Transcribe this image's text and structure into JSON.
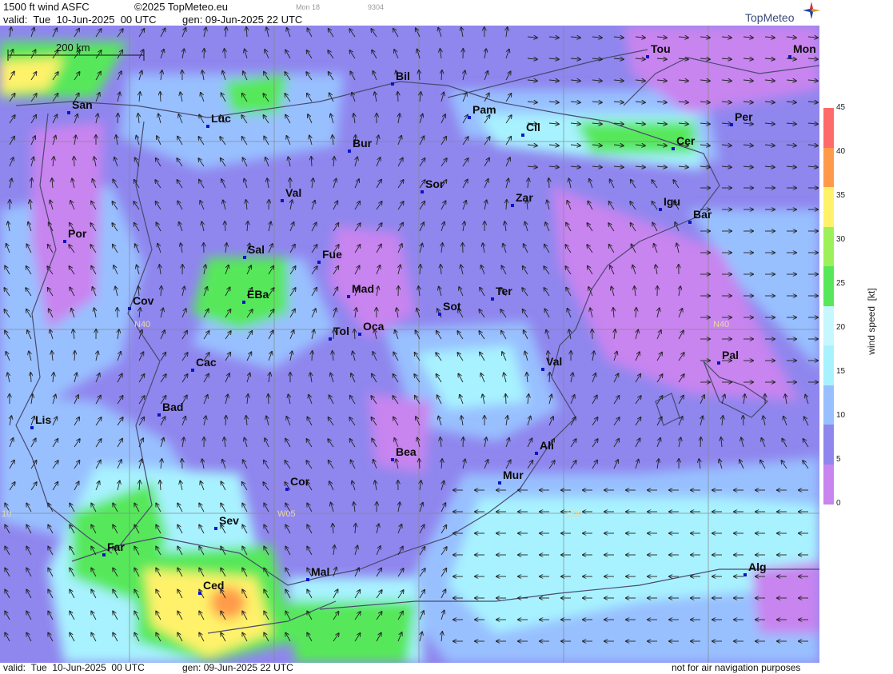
{
  "header": {
    "product": "1500 ft wind ASFC",
    "copyright": "©2025 TopMeteo.eu",
    "model_tag": "Mon 18",
    "code": "9304",
    "valid": "valid:  Tue  10-Jun-2025  00 UTC",
    "generated": "gen: 09-Jun-2025 22 UTC",
    "brand": "TopMeteo"
  },
  "footer": {
    "valid": "valid:  Tue  10-Jun-2025  00 UTC",
    "generated": "gen: 09-Jun-2025 22 UTC",
    "disclaimer": "not for air navigation purposes"
  },
  "scale_bar": {
    "label": "200 km"
  },
  "grid_labels": [
    "N40",
    "N40",
    "W05",
    "E00",
    "10"
  ],
  "cities": [
    {
      "name": "San"
    },
    {
      "name": "Luc"
    },
    {
      "name": "Bil"
    },
    {
      "name": "Pam"
    },
    {
      "name": "Cil"
    },
    {
      "name": "Tou"
    },
    {
      "name": "Mon"
    },
    {
      "name": "Per"
    },
    {
      "name": "Cer"
    },
    {
      "name": "Bur"
    },
    {
      "name": "Sor"
    },
    {
      "name": "Zar"
    },
    {
      "name": "Igu"
    },
    {
      "name": "Bar"
    },
    {
      "name": "Val"
    },
    {
      "name": "Por"
    },
    {
      "name": "Sal"
    },
    {
      "name": "Fue"
    },
    {
      "name": "Mad"
    },
    {
      "name": "EBa"
    },
    {
      "name": "Ter"
    },
    {
      "name": "Cov"
    },
    {
      "name": "Sot"
    },
    {
      "name": "Tol"
    },
    {
      "name": "Oca"
    },
    {
      "name": "Pal"
    },
    {
      "name": "Cac"
    },
    {
      "name": "Val"
    },
    {
      "name": "Bad"
    },
    {
      "name": "Lis"
    },
    {
      "name": "Bea"
    },
    {
      "name": "Ali"
    },
    {
      "name": "Mur"
    },
    {
      "name": "Cor"
    },
    {
      "name": "Sev"
    },
    {
      "name": "Far"
    },
    {
      "name": "Mal"
    },
    {
      "name": "Alg"
    },
    {
      "name": "Ced"
    }
  ],
  "colorbar": {
    "title": "wind speed  [kt]",
    "ticks": [
      "45",
      "40",
      "35",
      "30",
      "25",
      "20",
      "15",
      "10",
      "5",
      "0"
    ],
    "colors": {
      "c0": "#c884ef",
      "c5": "#8f86ee",
      "c10": "#98c0ff",
      "c15": "#a8f2ff",
      "c20": "#c6f7ff",
      "c25": "#56e85a",
      "c30": "#9cf05a",
      "c35": "#fff26a",
      "c40": "#ff9a4a",
      "c45": "#ff6a6a"
    }
  }
}
